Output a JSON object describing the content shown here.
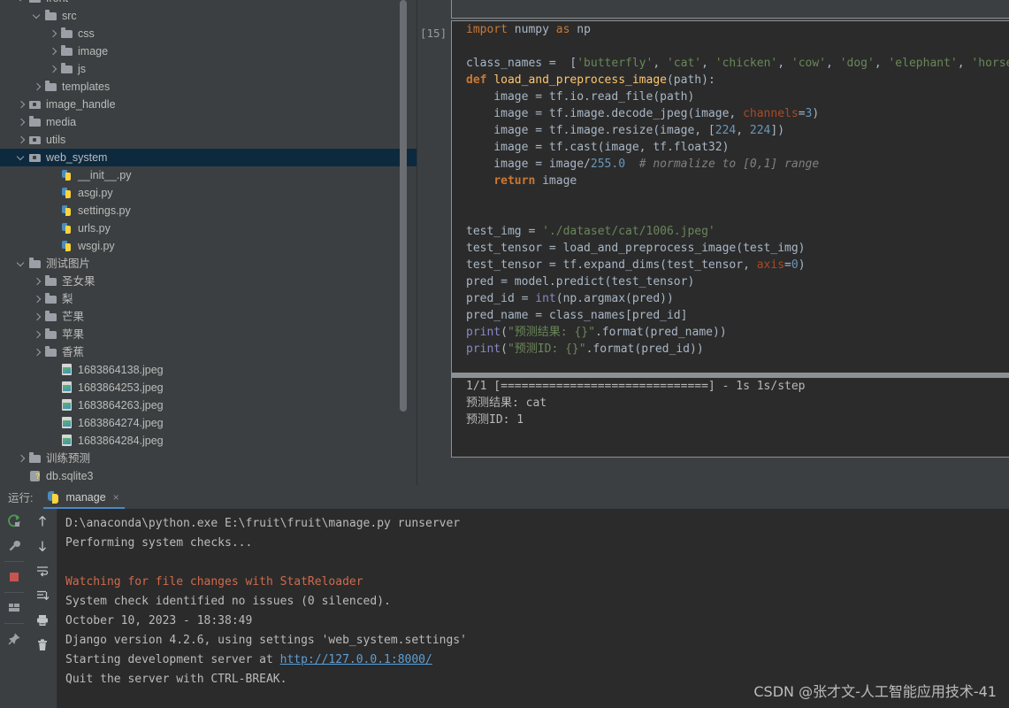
{
  "project_tree": {
    "scrollbar": "vertical-scrollbar",
    "items": [
      {
        "label": "front",
        "indent": 1,
        "twisty": "open",
        "icon": "folder-icon",
        "cut": true,
        "selected": false
      },
      {
        "label": "src",
        "indent": 2,
        "twisty": "open",
        "icon": "folder-icon",
        "cut": false,
        "selected": false
      },
      {
        "label": "css",
        "indent": 3,
        "twisty": "closed",
        "icon": "folder-icon",
        "cut": false,
        "selected": false
      },
      {
        "label": "image",
        "indent": 3,
        "twisty": "closed",
        "icon": "folder-icon",
        "cut": false,
        "selected": false
      },
      {
        "label": "js",
        "indent": 3,
        "twisty": "closed",
        "icon": "folder-icon",
        "cut": false,
        "selected": false
      },
      {
        "label": "templates",
        "indent": 2,
        "twisty": "closed",
        "icon": "folder-icon",
        "cut": false,
        "selected": false
      },
      {
        "label": "image_handle",
        "indent": 1,
        "twisty": "closed",
        "icon": "module-folder-icon",
        "cut": false,
        "selected": false
      },
      {
        "label": "media",
        "indent": 1,
        "twisty": "closed",
        "icon": "folder-icon",
        "cut": false,
        "selected": false
      },
      {
        "label": "utils",
        "indent": 1,
        "twisty": "closed",
        "icon": "module-folder-icon",
        "cut": false,
        "selected": false
      },
      {
        "label": "web_system",
        "indent": 1,
        "twisty": "open",
        "icon": "module-folder-icon",
        "cut": false,
        "selected": true
      },
      {
        "label": "__init__.py",
        "indent": 3,
        "twisty": "none",
        "icon": "python-file-icon",
        "cut": false,
        "selected": false
      },
      {
        "label": "asgi.py",
        "indent": 3,
        "twisty": "none",
        "icon": "python-file-icon",
        "cut": false,
        "selected": false
      },
      {
        "label": "settings.py",
        "indent": 3,
        "twisty": "none",
        "icon": "python-file-icon",
        "cut": false,
        "selected": false
      },
      {
        "label": "urls.py",
        "indent": 3,
        "twisty": "none",
        "icon": "python-file-icon",
        "cut": false,
        "selected": false
      },
      {
        "label": "wsgi.py",
        "indent": 3,
        "twisty": "none",
        "icon": "python-file-icon",
        "cut": false,
        "selected": false
      },
      {
        "label": "测试图片",
        "indent": 1,
        "twisty": "open",
        "icon": "folder-icon",
        "cut": false,
        "selected": false
      },
      {
        "label": "圣女果",
        "indent": 2,
        "twisty": "closed",
        "icon": "folder-icon",
        "cut": false,
        "selected": false
      },
      {
        "label": "梨",
        "indent": 2,
        "twisty": "closed",
        "icon": "folder-icon",
        "cut": false,
        "selected": false
      },
      {
        "label": "芒果",
        "indent": 2,
        "twisty": "closed",
        "icon": "folder-icon",
        "cut": false,
        "selected": false
      },
      {
        "label": "苹果",
        "indent": 2,
        "twisty": "closed",
        "icon": "folder-icon",
        "cut": false,
        "selected": false
      },
      {
        "label": "香蕉",
        "indent": 2,
        "twisty": "closed",
        "icon": "folder-icon",
        "cut": false,
        "selected": false
      },
      {
        "label": "1683864138.jpeg",
        "indent": 3,
        "twisty": "none",
        "icon": "image-file-icon",
        "cut": false,
        "selected": false
      },
      {
        "label": "1683864253.jpeg",
        "indent": 3,
        "twisty": "none",
        "icon": "image-file-icon",
        "cut": false,
        "selected": false
      },
      {
        "label": "1683864263.jpeg",
        "indent": 3,
        "twisty": "none",
        "icon": "image-file-icon",
        "cut": false,
        "selected": false
      },
      {
        "label": "1683864274.jpeg",
        "indent": 3,
        "twisty": "none",
        "icon": "image-file-icon",
        "cut": false,
        "selected": false
      },
      {
        "label": "1683864284.jpeg",
        "indent": 3,
        "twisty": "none",
        "icon": "image-file-icon",
        "cut": false,
        "selected": false
      },
      {
        "label": "训练预测",
        "indent": 1,
        "twisty": "closed",
        "icon": "folder-icon",
        "cut": false,
        "selected": false
      },
      {
        "label": "db.sqlite3",
        "indent": 1,
        "twisty": "none",
        "icon": "database-file-icon",
        "cut": false,
        "selected": false
      }
    ]
  },
  "notebook": {
    "cell_label": "[15]",
    "code_lines": [
      [
        {
          "t": "import ",
          "c": "k"
        },
        {
          "t": "numpy ",
          "c": "pl"
        },
        {
          "t": "as ",
          "c": "k"
        },
        {
          "t": "np",
          "c": "pl"
        }
      ],
      [],
      [
        {
          "t": "class_names = ",
          "c": "pl"
        },
        {
          "t": " [",
          "c": "pl"
        },
        {
          "t": "'butterfly'",
          "c": "s"
        },
        {
          "t": ", ",
          "c": "pl"
        },
        {
          "t": "'cat'",
          "c": "s"
        },
        {
          "t": ", ",
          "c": "pl"
        },
        {
          "t": "'chicken'",
          "c": "s"
        },
        {
          "t": ", ",
          "c": "pl"
        },
        {
          "t": "'cow'",
          "c": "s"
        },
        {
          "t": ", ",
          "c": "pl"
        },
        {
          "t": "'dog'",
          "c": "s"
        },
        {
          "t": ", ",
          "c": "pl"
        },
        {
          "t": "'elephant'",
          "c": "s"
        },
        {
          "t": ", ",
          "c": "pl"
        },
        {
          "t": "'horse",
          "c": "s"
        }
      ],
      [
        {
          "t": "def ",
          "c": "kb"
        },
        {
          "t": "load_and_preprocess_image",
          "c": "fn"
        },
        {
          "t": "(path):",
          "c": "pl"
        }
      ],
      [
        {
          "t": "    image = tf.io.read_file(path)",
          "c": "pl"
        }
      ],
      [
        {
          "t": "    image = tf.image.decode_jpeg(image, ",
          "c": "pl"
        },
        {
          "t": "channels",
          "c": "kwarg"
        },
        {
          "t": "=",
          "c": "pl"
        },
        {
          "t": "3",
          "c": "n"
        },
        {
          "t": ")",
          "c": "pl"
        }
      ],
      [
        {
          "t": "    image = tf.image.resize(image, [",
          "c": "pl"
        },
        {
          "t": "224",
          "c": "n"
        },
        {
          "t": ", ",
          "c": "pl"
        },
        {
          "t": "224",
          "c": "n"
        },
        {
          "t": "])",
          "c": "pl"
        }
      ],
      [
        {
          "t": "    image = tf.cast(image, tf.float32)",
          "c": "pl"
        }
      ],
      [
        {
          "t": "    image = image/",
          "c": "pl"
        },
        {
          "t": "255.0",
          "c": "n"
        },
        {
          "t": "  ",
          "c": "pl"
        },
        {
          "t": "# normalize to [0,1] range",
          "c": "cm"
        }
      ],
      [
        {
          "t": "    ",
          "c": "pl"
        },
        {
          "t": "return ",
          "c": "kb"
        },
        {
          "t": "image",
          "c": "pl"
        }
      ],
      [],
      [],
      [
        {
          "t": "test_img = ",
          "c": "pl"
        },
        {
          "t": "'./dataset/cat/1006.jpeg'",
          "c": "s"
        }
      ],
      [
        {
          "t": "test_tensor = load_and_preprocess_image(test_img)",
          "c": "pl"
        }
      ],
      [
        {
          "t": "test_tensor = tf.expand_dims(test_tensor, ",
          "c": "pl"
        },
        {
          "t": "axis",
          "c": "kwarg"
        },
        {
          "t": "=",
          "c": "pl"
        },
        {
          "t": "0",
          "c": "n"
        },
        {
          "t": ")",
          "c": "pl"
        }
      ],
      [
        {
          "t": "pred = model.predict(test_tensor)",
          "c": "pl"
        }
      ],
      [
        {
          "t": "pred_id = ",
          "c": "pl"
        },
        {
          "t": "int",
          "c": "pf"
        },
        {
          "t": "(np.argmax(pred))",
          "c": "pl"
        }
      ],
      [
        {
          "t": "pred_name = class_names[pred_id]",
          "c": "pl"
        }
      ],
      [
        {
          "t": "print",
          "c": "pf"
        },
        {
          "t": "(",
          "c": "pl"
        },
        {
          "t": "\"预测结果: {}\"",
          "c": "s"
        },
        {
          "t": ".format(pred_name))",
          "c": "pl"
        }
      ],
      [
        {
          "t": "print",
          "c": "pf"
        },
        {
          "t": "(",
          "c": "pl"
        },
        {
          "t": "\"预测ID: {}\"",
          "c": "s"
        },
        {
          "t": ".format(pred_id))",
          "c": "pl"
        }
      ]
    ],
    "output_lines": [
      "1/1 [==============================] - 1s 1s/step",
      "预测结果: cat",
      "预测ID: 1"
    ]
  },
  "console": {
    "run_label": "运行:",
    "tab_title": "manage",
    "tab_close": "×",
    "left_tools": [
      {
        "name": "rerun-icon"
      },
      {
        "name": "settings-wrench-icon"
      },
      {
        "name": "stop-icon"
      },
      {
        "name": "layout-icon"
      },
      {
        "name": "pin-icon"
      }
    ],
    "right_tools": [
      {
        "name": "scroll-up-icon"
      },
      {
        "name": "scroll-down-icon"
      },
      {
        "name": "soft-wrap-icon"
      },
      {
        "name": "scroll-to-end-icon"
      },
      {
        "name": "print-icon"
      },
      {
        "name": "clear-all-icon"
      }
    ],
    "output_lines": [
      {
        "text": "D:\\anaconda\\python.exe E:\\fruit\\fruit\\manage.py runserver",
        "style": "normal"
      },
      {
        "text": "Performing system checks...",
        "style": "normal"
      },
      {
        "text": "",
        "style": "normal"
      },
      {
        "text": "Watching for file changes with StatReloader",
        "style": "error"
      },
      {
        "text": "System check identified no issues (0 silenced).",
        "style": "normal"
      },
      {
        "text": "October 10, 2023 - 18:38:49",
        "style": "normal"
      },
      {
        "text": "Django version 4.2.6, using settings 'web_system.settings'",
        "style": "normal"
      },
      {
        "text": "Starting development server at ",
        "style": "link-prefix",
        "link": "http://127.0.0.1:8000/"
      },
      {
        "text": "Quit the server with CTRL-BREAK.",
        "style": "normal"
      }
    ]
  },
  "watermark": "CSDN @张才文-人工智能应用技术-41"
}
